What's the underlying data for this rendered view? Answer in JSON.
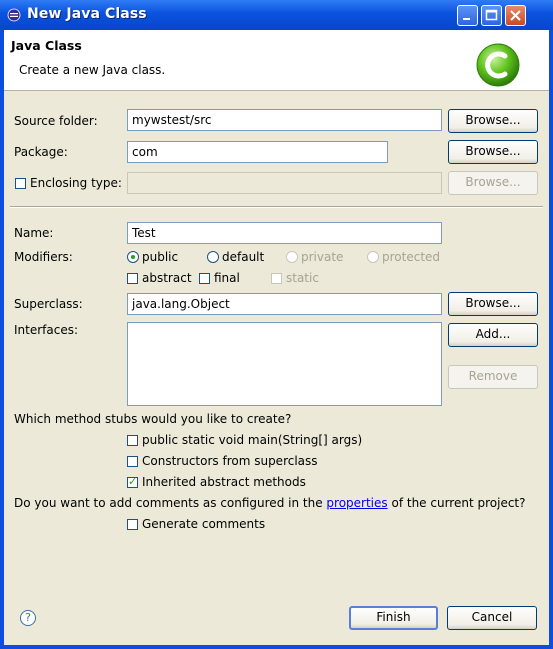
{
  "window": {
    "title": "New Java Class"
  },
  "header": {
    "title": "Java Class",
    "description": "Create a new Java class."
  },
  "source_folder": {
    "label": "Source folder:",
    "value": "mywstest/src",
    "browse": "Browse..."
  },
  "package": {
    "label": "Package:",
    "value": "com",
    "browse": "Browse..."
  },
  "enclosing": {
    "label": "Enclosing type:",
    "value": "",
    "browse": "Browse..."
  },
  "name": {
    "label": "Name:",
    "value": "Test"
  },
  "modifiers": {
    "label": "Modifiers:",
    "public": "public",
    "default": "default",
    "private": "private",
    "protected": "protected",
    "abstract": "abstract",
    "final": "final",
    "static": "static"
  },
  "superclass": {
    "label": "Superclass:",
    "value": "java.lang.Object",
    "browse": "Browse..."
  },
  "interfaces": {
    "label": "Interfaces:",
    "add": "Add...",
    "remove": "Remove"
  },
  "stubs": {
    "question": "Which method stubs would you like to create?",
    "main": "public static void main(String[] args)",
    "constructors": "Constructors from superclass",
    "inherited": "Inherited abstract methods"
  },
  "comments": {
    "question_prefix": "Do you want to add comments as configured in the",
    "link": "properties",
    "question_suffix": "of the current project?",
    "generate": "Generate comments"
  },
  "footer": {
    "help": "?",
    "finish": "Finish",
    "cancel": "Cancel"
  }
}
